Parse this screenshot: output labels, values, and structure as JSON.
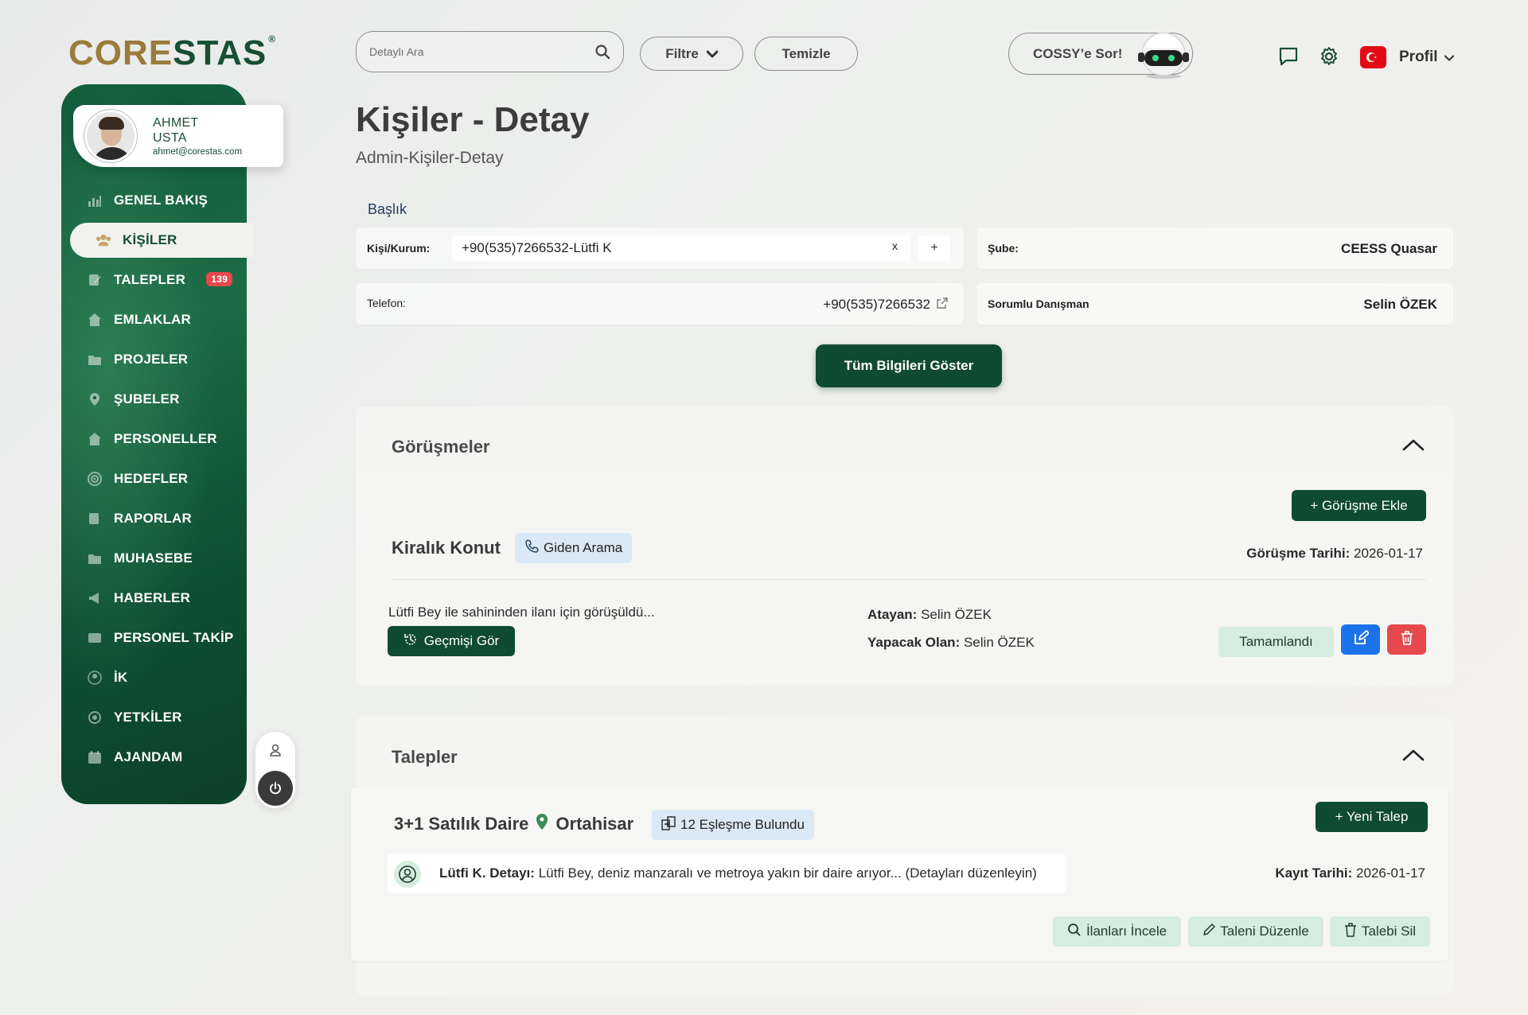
{
  "brand": {
    "logo_part1": "CORE",
    "logo_part2": "STAS",
    "trademark": "®"
  },
  "user": {
    "first": "AHMET",
    "last": "USTA",
    "email": "ahmet@corestas.com"
  },
  "sidebar": {
    "items": [
      {
        "label": "GENEL BAKIŞ",
        "icon": "chart-icon"
      },
      {
        "label": "KİŞİLER",
        "icon": "users-icon",
        "active": true
      },
      {
        "label": "TALEPLER",
        "icon": "edit-icon",
        "badge": "139"
      },
      {
        "label": "EMLAKLAR",
        "icon": "house-icon"
      },
      {
        "label": "PROJELER",
        "icon": "folder-icon"
      },
      {
        "label": "ŞUBELER",
        "icon": "pin-icon"
      },
      {
        "label": "PERSONELLER",
        "icon": "house-icon"
      },
      {
        "label": "HEDEFLER",
        "icon": "target-icon"
      },
      {
        "label": "RAPORLAR",
        "icon": "edit-icon"
      },
      {
        "label": "MUHASEBE",
        "icon": "folder-icon"
      },
      {
        "label": "HABERLER",
        "icon": "megaphone-icon"
      },
      {
        "label": "PERSONEL TAKİP",
        "icon": "card-icon"
      },
      {
        "label": "İK",
        "icon": "person-icon"
      },
      {
        "label": "YETKİLER",
        "icon": "gear-icon"
      },
      {
        "label": "AJANDAM",
        "icon": "calendar-icon"
      }
    ]
  },
  "topbar": {
    "search_placeholder": "Detaylı Ara",
    "filter_label": "Filtre",
    "clear_label": "Temizle",
    "assistant_label": "COSSY’e Sor!",
    "profile_label": "Profil"
  },
  "page": {
    "title": "Kişiler - Detay",
    "breadcrumb": "Admin-Kişiler-Detay"
  },
  "details": {
    "section_label": "Başlık",
    "kisi_label": "Kişi/Kurum:",
    "kisi_value": "+90(535)7266532-Lütfi K",
    "clear_x": "x",
    "add_plus": "+",
    "sube_label": "Şube:",
    "sube_value": "CEESS Quasar",
    "telefon_label": "Telefon:",
    "telefon_value": "+90(535)7266532",
    "danisman_label": "Sorumlu Danışman",
    "danisman_value": "Selin ÖZEK",
    "show_all_label": "Tüm Bilgileri Göster"
  },
  "gorusmeler": {
    "title": "Görüşmeler",
    "add_label": "+ Görüşme Ekle",
    "item": {
      "title": "Kiralık Konut",
      "type": "Giden Arama",
      "date_label": "Görüşme Tarihi:",
      "date": "2026-01-17",
      "note": "Lütfi Bey ile sahininden ilanı için görüşüldü...",
      "history_label": "Geçmişi Gör",
      "assigner_label": "Atayan:",
      "assigner": "Selin ÖZEK",
      "doer_label": "Yapacak Olan:",
      "doer": "Selin ÖZEK",
      "status": "Tamamlandı"
    }
  },
  "talepler": {
    "title": "Talepler",
    "new_label": "+ Yeni Talep",
    "item": {
      "title": "3+1 Satılık Daire",
      "location": "Ortahisar",
      "matches": "12 Eşleşme Bulundu",
      "detail_label": "Lütfi K. Detayı:",
      "detail_text": "Lütfi Bey, deniz manzaralı ve metroya yakın bir daire arıyor... (Detayları düzenleyin)",
      "date_label": "Kayıt Tarihi:",
      "date": "2026-01-17",
      "btn_review": "İlanları İncele",
      "btn_edit": "Taleni Düzenle",
      "btn_delete": "Talebi Sil"
    }
  },
  "colors": {
    "primary": "#0f4a32",
    "accent_gold": "#9a7b3b",
    "danger": "#e5484d",
    "blue": "#1a73e8"
  }
}
